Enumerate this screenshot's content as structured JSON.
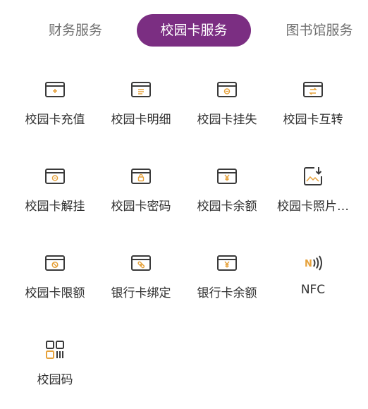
{
  "tabs": [
    {
      "label": "财务服务",
      "active": false
    },
    {
      "label": "校园卡服务",
      "active": true
    },
    {
      "label": "图书馆服务",
      "active": false
    }
  ],
  "colors": {
    "accent": "#7b2e82",
    "icon_stroke": "#3a3a3a",
    "icon_highlight": "#e6a23c"
  },
  "services": [
    {
      "label": "校园卡充值",
      "icon": "card-topup-icon"
    },
    {
      "label": "校园卡明细",
      "icon": "card-detail-icon"
    },
    {
      "label": "校园卡挂失",
      "icon": "card-report-loss-icon"
    },
    {
      "label": "校园卡互转",
      "icon": "card-transfer-icon"
    },
    {
      "label": "校园卡解挂",
      "icon": "card-unlock-icon"
    },
    {
      "label": "校园卡密码",
      "icon": "card-password-icon"
    },
    {
      "label": "校园卡余额",
      "icon": "card-balance-icon"
    },
    {
      "label": "校园卡照片…",
      "icon": "photo-download-icon"
    },
    {
      "label": "校园卡限额",
      "icon": "card-limit-icon"
    },
    {
      "label": "银行卡绑定",
      "icon": "bank-card-bind-icon"
    },
    {
      "label": "银行卡余额",
      "icon": "bank-card-balance-icon"
    },
    {
      "label": "NFC",
      "icon": "nfc-icon"
    },
    {
      "label": "校园码",
      "icon": "qr-code-icon"
    }
  ]
}
